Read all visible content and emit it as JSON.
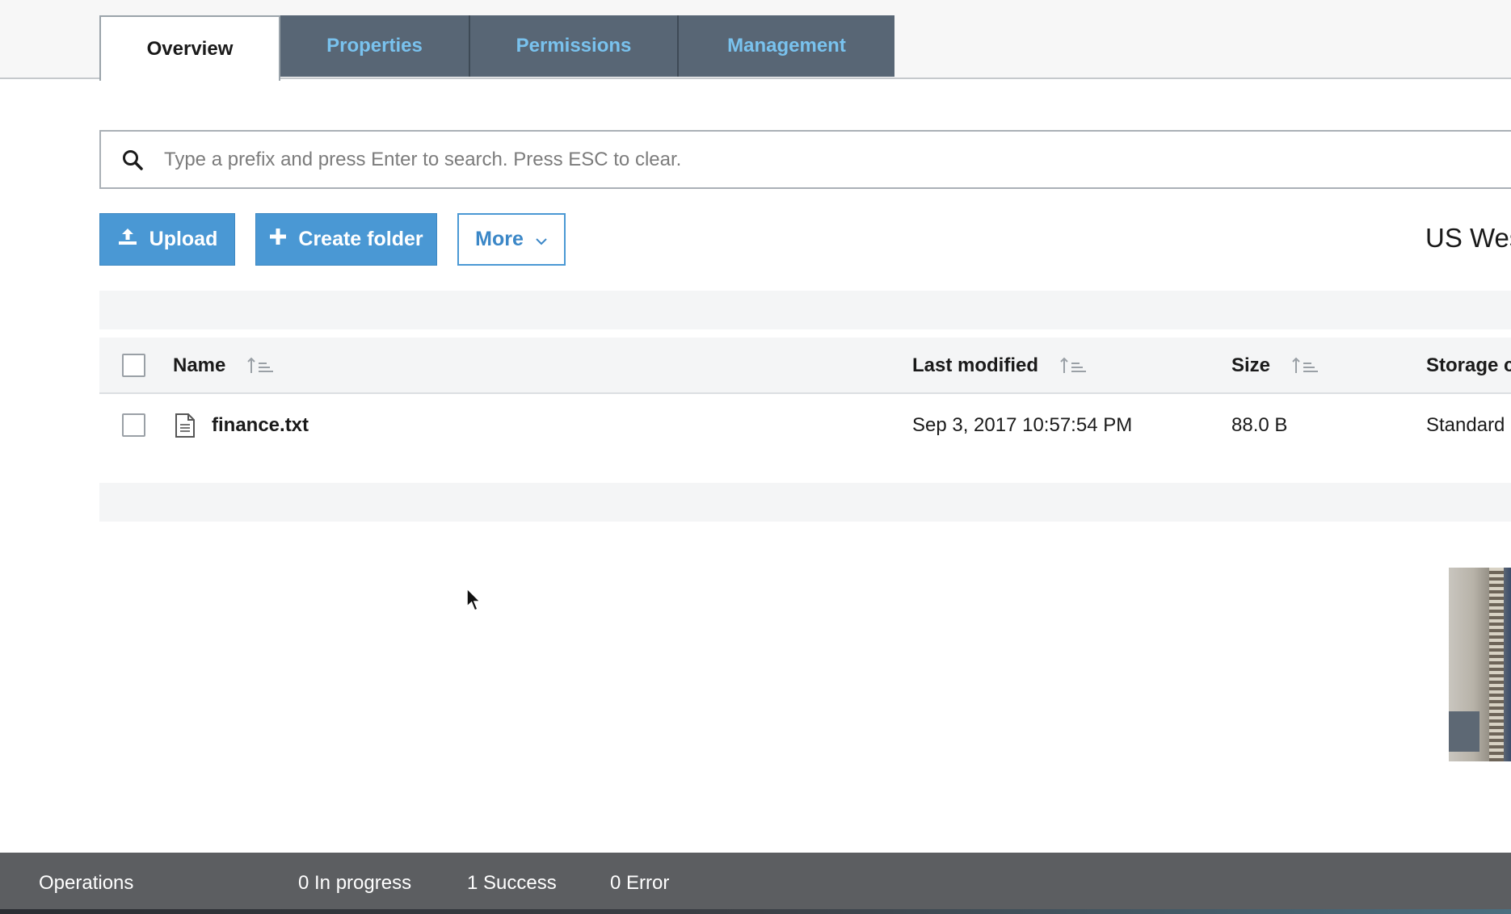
{
  "tabs": [
    {
      "label": "Overview",
      "active": true
    },
    {
      "label": "Properties",
      "active": false
    },
    {
      "label": "Permissions",
      "active": false
    },
    {
      "label": "Management",
      "active": false
    }
  ],
  "search": {
    "placeholder": "Type a prefix and press Enter to search. Press ESC to clear.",
    "value": ""
  },
  "toolbar": {
    "upload_label": "Upload",
    "create_folder_label": "Create folder",
    "more_label": "More",
    "region": "US Wes"
  },
  "table": {
    "columns": [
      "Name",
      "Last modified",
      "Size",
      "Storage c"
    ],
    "rows": [
      {
        "name": "finance.txt",
        "last_modified": "Sep 3, 2017 10:57:54 PM",
        "size": "88.0 B",
        "storage_class": "Standard"
      }
    ]
  },
  "operations": {
    "label": "Operations",
    "in_progress": "0 In progress",
    "success": "1 Success",
    "error": "0 Error"
  },
  "colors": {
    "tab_inactive_bg": "#586675",
    "tab_inactive_text": "#79c2ee",
    "primary_button": "#4a98d4",
    "footer_bg": "#5c5e61"
  },
  "icons": [
    "search-icon",
    "upload-icon",
    "plus-icon",
    "chevron-down-icon",
    "sort-icon",
    "file-icon",
    "cursor-icon"
  ]
}
